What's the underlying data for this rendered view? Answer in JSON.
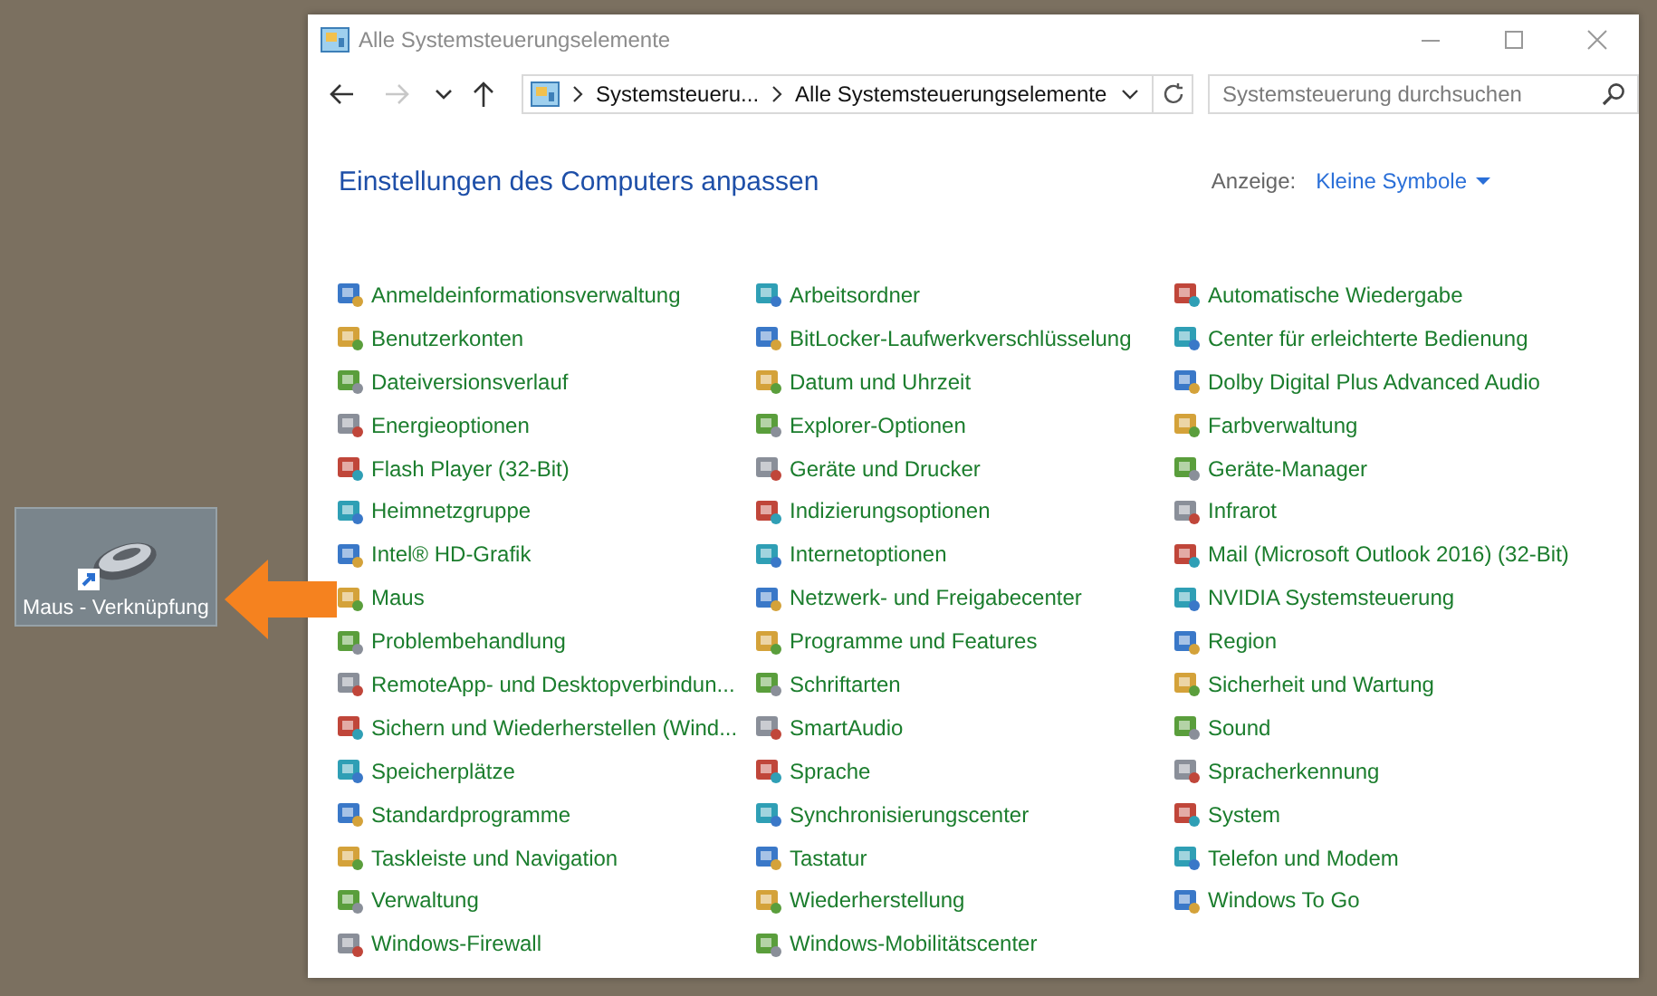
{
  "desktop_shortcut": {
    "label": "Maus - Verknüpfung",
    "selected": true
  },
  "window": {
    "title": "Alle Systemsteuerungselemente"
  },
  "nav_buttons": [
    {
      "kind": "back",
      "disabled": false
    },
    {
      "kind": "forward",
      "disabled": true
    },
    {
      "kind": "recent",
      "disabled": false
    },
    {
      "kind": "up",
      "disabled": false
    }
  ],
  "address_bar": {
    "crumbs": [
      "Systemsteueru...",
      "Alle Systemsteuerungselemente"
    ]
  },
  "search": {
    "placeholder": "Systemsteuerung durchsuchen"
  },
  "heading": "Einstellungen des Computers anpassen",
  "view": {
    "label": "Anzeige:",
    "value": "Kleine Symbole"
  },
  "columns": [
    {
      "items": [
        "Anmeldeinformationsverwaltung",
        "Benutzerkonten",
        "Dateiversionsverlauf",
        "Energieoptionen",
        "Flash Player (32-Bit)",
        "Heimnetzgruppe",
        "Intel® HD-Grafik",
        "Maus",
        "Problembehandlung",
        "RemoteApp- und Desktopverbindun...",
        "Sichern und Wiederherstellen (Wind...",
        "Speicherplätze",
        "Standardprogramme",
        "Taskleiste und Navigation",
        "Verwaltung",
        "Windows-Firewall"
      ]
    },
    {
      "items": [
        "Arbeitsordner",
        "BitLocker-Laufwerkverschlüsselung",
        "Datum und Uhrzeit",
        "Explorer-Optionen",
        "Geräte und Drucker",
        "Indizierungsoptionen",
        "Internetoptionen",
        "Netzwerk- und Freigabecenter",
        "Programme und Features",
        "Schriftarten",
        "SmartAudio",
        "Sprache",
        "Synchronisierungscenter",
        "Tastatur",
        "Wiederherstellung",
        "Windows-Mobilitätscenter"
      ]
    },
    {
      "items": [
        "Automatische Wiedergabe",
        "Center für erleichterte Bedienung",
        "Dolby Digital Plus Advanced Audio",
        "Farbverwaltung",
        "Geräte-Manager",
        "Infrarot",
        "Mail (Microsoft Outlook 2016) (32-Bit)",
        "NVIDIA Systemsteuerung",
        "Region",
        "Sicherheit und Wartung",
        "Sound",
        "Spracherkennung",
        "System",
        "Telefon und Modem",
        "Windows To Go"
      ]
    }
  ]
}
